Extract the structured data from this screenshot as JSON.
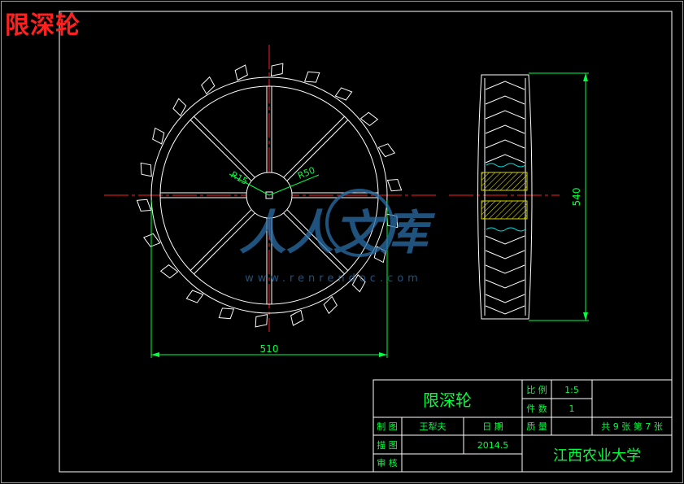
{
  "header": {
    "title_text": "限深轮"
  },
  "dimensions": {
    "r15": "R15",
    "r50": "R50",
    "diameter_510": "510",
    "height_540": "540"
  },
  "watermark": {
    "logo_text": "人人文库",
    "url": "www.renrendoc.com"
  },
  "title_block": {
    "part_name": "限深轮",
    "scale_label": "比 例",
    "scale_value": "1:5",
    "quantity_label": "件 数",
    "quantity_value": "1",
    "drawn_label": "制 图",
    "drawn_name": "王犁夫",
    "date_label": "日 期",
    "mass_label": "质 量",
    "sheet_info": "共 9 张  第 7 张",
    "traced_label": "描 图",
    "date_value": "2014.5",
    "institution": "江西农业大学",
    "checked_label": "审 核"
  },
  "colors": {
    "border": "#ffffff",
    "outline": "#00e0e0",
    "geometry": "#ffffff",
    "centerline": "#ff2020",
    "dimension": "#00ff40",
    "title_block_text": "#00ff40",
    "hatch": "#d4d400",
    "watermark": "#2a6fa8"
  }
}
